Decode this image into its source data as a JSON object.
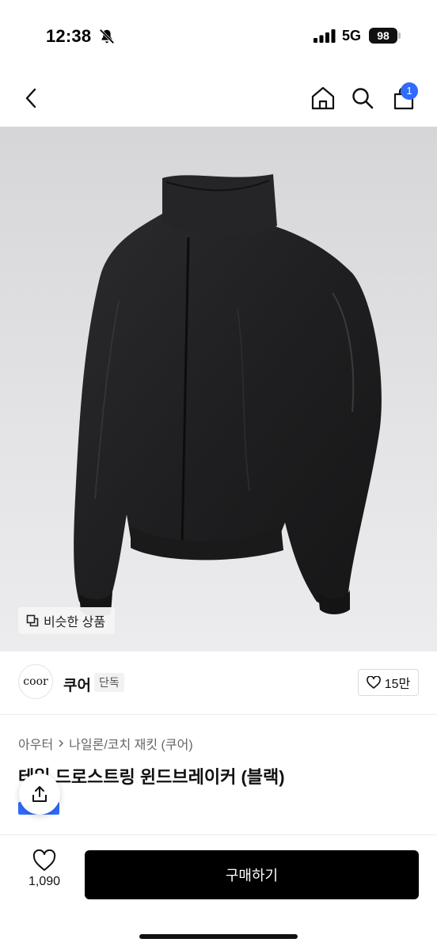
{
  "status_bar": {
    "time": "12:38",
    "network": "5G",
    "battery": "98"
  },
  "nav": {
    "cart_count": "1"
  },
  "image": {
    "similar_label": "비슷한 상품"
  },
  "brand": {
    "logo_text": "coor",
    "name": "쿠어",
    "badge": "단독",
    "likes": "15만"
  },
  "breadcrumb": {
    "items": [
      "아우터",
      "나일론/코치 재킷 (쿠어)"
    ]
  },
  "product": {
    "title": "테일 드로스트링 윈드브레이커 (블랙)"
  },
  "bottom_bar": {
    "wish_count": "1,090",
    "buy_label": "구매하기"
  },
  "colors": {
    "accent": "#2f6bff",
    "buy_button": "#000000"
  }
}
